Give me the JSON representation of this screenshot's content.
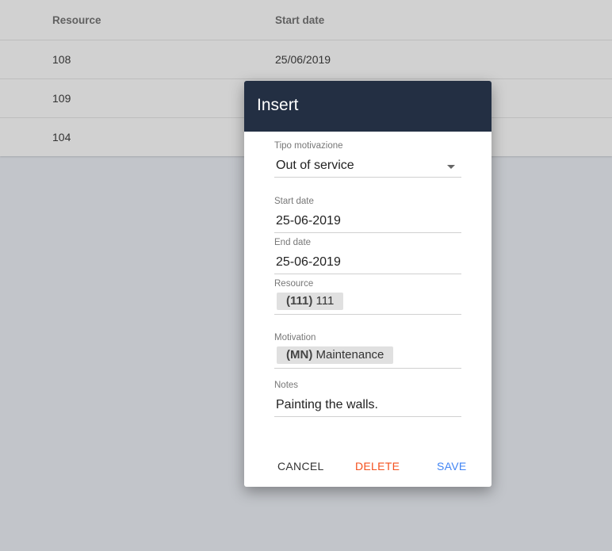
{
  "table": {
    "columns": [
      "Resource",
      "Start date"
    ],
    "rows": [
      [
        "108",
        "25/06/2019"
      ],
      [
        "109",
        ""
      ],
      [
        "104",
        ""
      ]
    ]
  },
  "dialog": {
    "title": "Insert",
    "tipo_motivazione": {
      "label": "Tipo motivazione",
      "value": "Out of service"
    },
    "start_date": {
      "label": "Start date",
      "value": "25-06-2019"
    },
    "end_date": {
      "label": "End date",
      "value": "25-06-2019"
    },
    "resource": {
      "label": "Resource",
      "code": "(111)",
      "name": "111"
    },
    "motivation": {
      "label": "Motivation",
      "code": "(MN)",
      "name": "Maintenance"
    },
    "notes": {
      "label": "Notes",
      "value": "Painting the walls."
    },
    "buttons": {
      "cancel": "CANCEL",
      "delete": "DELETE",
      "save": "SAVE"
    }
  },
  "colors": {
    "header_bg": "#232f43",
    "cancel": "#333333",
    "delete": "#f4511e",
    "save": "#4285f4",
    "overlay": "#c2c5ca"
  }
}
